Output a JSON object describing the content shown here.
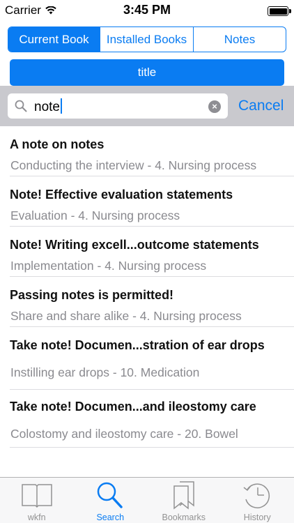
{
  "status_bar": {
    "carrier": "Carrier",
    "time": "3:45 PM",
    "icons": [
      "wifi-icon",
      "battery-icon"
    ]
  },
  "segments": [
    {
      "label": "Current Book",
      "selected": true
    },
    {
      "label": "Installed Books",
      "selected": false
    },
    {
      "label": "Notes",
      "selected": false
    }
  ],
  "title_button": {
    "label": "title"
  },
  "search": {
    "value": "note",
    "cancel_label": "Cancel",
    "icon": "search-icon"
  },
  "results": [
    {
      "title": "A note on notes",
      "subtitle": "Conducting the interview - 4. Nursing process"
    },
    {
      "title": "Note! Effective evaluation statements",
      "subtitle": "Evaluation - 4. Nursing process"
    },
    {
      "title": "Note! Writing excell...outcome statements",
      "subtitle": "Implementation - 4. Nursing process"
    },
    {
      "title": "Passing notes is permitted!",
      "subtitle": "Share and share alike - 4. Nursing process"
    },
    {
      "title": "Take note! Documen...stration of ear drops",
      "subtitle": "Instilling ear drops - 10. Medication"
    },
    {
      "title": "Take note! Documen...and ileostomy care",
      "subtitle": "Colostomy and ileostomy care - 20. Bowel"
    }
  ],
  "tabbar": [
    {
      "label": "wkfn",
      "icon": "book-icon",
      "active": false
    },
    {
      "label": "Search",
      "icon": "search-icon",
      "active": true
    },
    {
      "label": "Bookmarks",
      "icon": "bookmarks-icon",
      "active": false
    },
    {
      "label": "History",
      "icon": "history-clock-icon",
      "active": false
    }
  ],
  "colors": {
    "accent": "#0a7cf2",
    "search_bg": "#c9c9ce",
    "subtitle": "#8a8a8f",
    "tab_inactive": "#929292"
  }
}
